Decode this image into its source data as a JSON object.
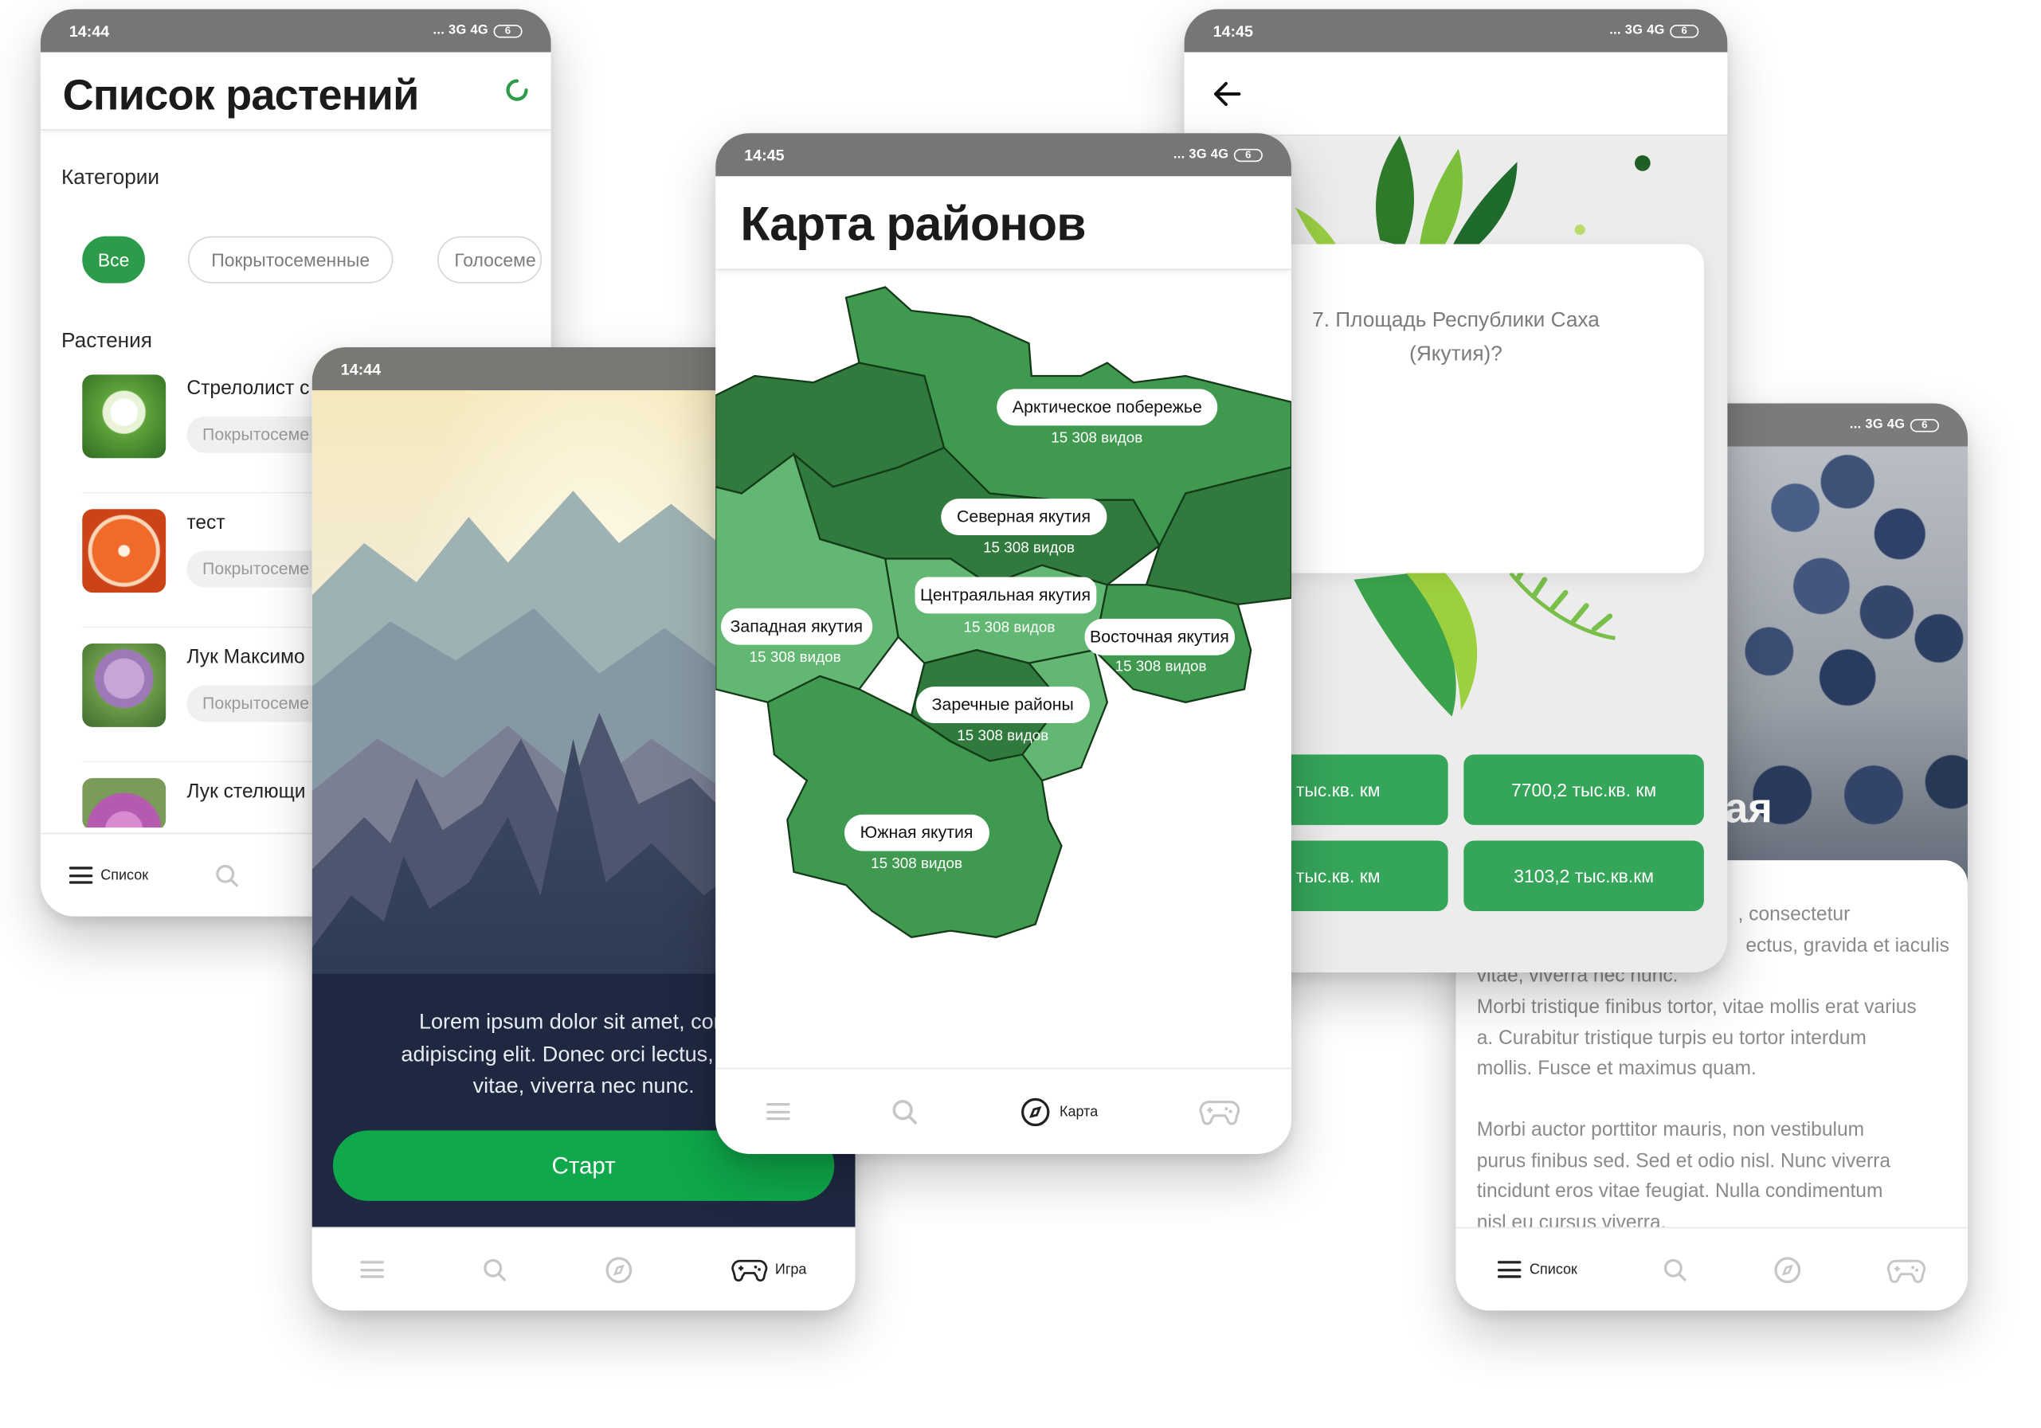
{
  "brand": {
    "accent": "#2c9b4a",
    "accent_bright": "#0fa84a",
    "map_dark": "#2f7a3c",
    "map_mid": "#3f9a4f",
    "map_light": "#62b872",
    "status_bar": "#767676"
  },
  "phone_list": {
    "status": {
      "time": "14:44",
      "signal": "... 3G 4G",
      "battery": "6"
    },
    "title": "Список растений",
    "refresh_icon": "refresh-icon",
    "categories_heading": "Категории",
    "chips": [
      "Все",
      "Покрытосеменные",
      "Голосеме"
    ],
    "plants_heading": "Растения",
    "plants": [
      {
        "name": "Стрелолист с",
        "tag": "Покрытосеме"
      },
      {
        "name": "тест",
        "tag": "Покрытосеме"
      },
      {
        "name": "Лук Максимо",
        "tag": "Покрытосеме"
      },
      {
        "name": "Лук стелющи",
        "tag": ""
      }
    ],
    "nav": {
      "list_label": "Список"
    }
  },
  "phone_game": {
    "status": {
      "time": "14:44",
      "signal": "..."
    },
    "text_lines": [
      "Lorem ipsum dolor sit amet, conse",
      "adipiscing elit. Donec orci lectus, gravi",
      "vitae, viverra nec nunc."
    ],
    "start_button": "Старт",
    "nav": {
      "game_label": "Игра"
    }
  },
  "phone_map": {
    "status": {
      "time": "14:45",
      "signal": "... 3G 4G",
      "battery": "6"
    },
    "title": "Карта районов",
    "regions": [
      {
        "name": "Арктическое побережье",
        "count": "15 308 видов"
      },
      {
        "name": "Северная якутия",
        "count": "15 308 видов"
      },
      {
        "name": "Центраяльная якутия",
        "count": "15 308 видов"
      },
      {
        "name": "Западная якутия",
        "count": "15 308 видов"
      },
      {
        "name": "Восточная якутия",
        "count": "15 308 видов"
      },
      {
        "name": "Заречные районы",
        "count": "15 308 видов"
      },
      {
        "name": "Южная якутия",
        "count": "15 308 видов"
      }
    ],
    "nav": {
      "map_label": "Карта"
    }
  },
  "phone_quiz": {
    "status": {
      "time": "14:45",
      "signal": "... 3G 4G",
      "battery": "6"
    },
    "question": "7. Площадь Республики Саха (Якутия)?",
    "answers": [
      "5 тыс.кв. км",
      "7700,2 тыс.кв. км",
      "2 тыс.кв. км",
      "3103,2 тыс.кв.км"
    ]
  },
  "phone_detail": {
    "status": {
      "signal": "... 3G 4G",
      "battery": "6"
    },
    "title_fragment": "ая",
    "paragraph_top": [
      ", consectetur",
      "ectus, gravida et iaculis",
      "vitae, viverra nec nunc."
    ],
    "paragraph_1": [
      "Morbi tristique finibus tortor, vitae mollis erat varius",
      "a. Curabitur tristique turpis eu tortor interdum",
      "mollis. Fusce et maximus quam."
    ],
    "paragraph_2": [
      "Morbi auctor porttitor mauris, non vestibulum",
      "purus finibus sed. Sed et odio nisl. Nunc viverra",
      "tincidunt eros vitae feugiat. Nulla condimentum",
      "nisl eu cursus viverra."
    ],
    "nav": {
      "list_label": "Список"
    }
  }
}
